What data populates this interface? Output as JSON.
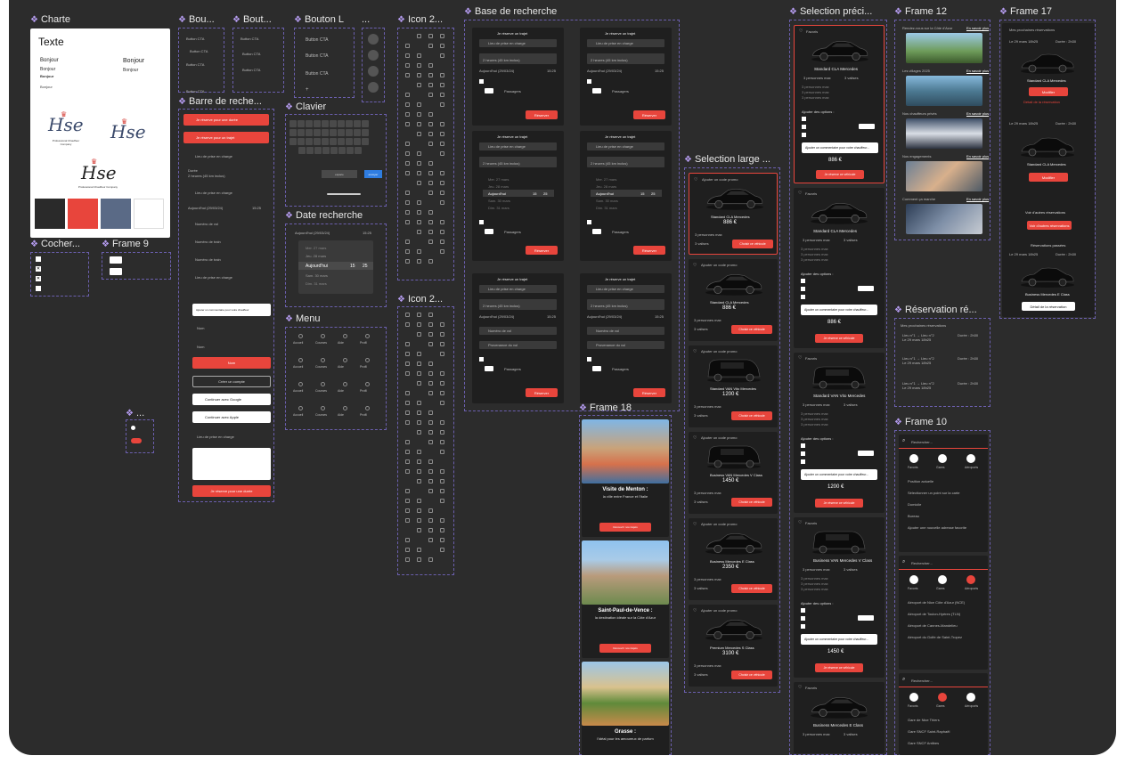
{
  "canvas": {
    "background": "#2c2c2c",
    "accent": "#e8453c",
    "panel": "#1f1f1f"
  },
  "frames": {
    "charte": "Charte",
    "bouton1": "Bou...",
    "bouton2": "Bout...",
    "boutonL": "Bouton L",
    "dots": "...",
    "icon1": "Icon 2...",
    "icon2": "Icon 2...",
    "base": "Base de recherche",
    "selPrec": "Selection préci...",
    "frame12": "Frame 12",
    "frame17": "Frame 17",
    "selLarge": "Selection large ...",
    "cocher": "Cocher...",
    "frame9": "Frame 9",
    "barre": "Barre de reche...",
    "clavier": "Clavier",
    "dateRech": "Date recherche",
    "menu": "Menu",
    "frame18": "Frame 18",
    "resa": "Réservation ré...",
    "frame10": "Frame 10",
    "dots2": "..."
  },
  "charte": {
    "title": "Texte",
    "bonjour": [
      "Bonjour",
      "Bonjour",
      "Bonjour",
      "Bonjour",
      "Bonjour",
      "Bonjour"
    ],
    "logo_text": "Hse",
    "logo_sub": "Professional Chauffeur Company",
    "swatches": [
      "#2a2a2a",
      "#e8453c",
      "#5a6a86",
      "#ffffff"
    ]
  },
  "buttons": {
    "cta": "Button CTA",
    "ctaL": "Button CTA"
  },
  "barre": {
    "r1": "Je réserve pour une durée",
    "r2": "Je réserve pour un trajet",
    "lieu": "Lieu de prise en charge",
    "duree": "Durée",
    "duree_val": "2 heures (45 km inclus)",
    "date": "Aujourd'hui (29/03/24)",
    "heure": "15:25",
    "vol": "Numéro de vol",
    "train": "Numéro de train",
    "nom": "Nom",
    "note": "Ajouter un commentaire pour votre chauffeur",
    "create": "Créer un compte",
    "google": "Continuer avec Google",
    "apple": "Continuer avec Apple"
  },
  "clavier": {
    "space": "espace",
    "send": "envoyer"
  },
  "date": {
    "header": "Aujourd'hui (29/03/24)",
    "time": "15:25",
    "rows": [
      "Mer. 27 mars",
      "Jeu. 28 mars",
      "Aujourd'hui",
      "Sam. 30 mars",
      "Dim. 31 mars"
    ],
    "hours": [
      "13",
      "14",
      "15",
      "16",
      "17"
    ],
    "mins": [
      "23",
      "24",
      "25",
      "26",
      "27"
    ]
  },
  "menu": {
    "items": [
      "Accueil",
      "Courses",
      "Aide",
      "Profil"
    ]
  },
  "base": {
    "title": "Je réserve un trajet",
    "lieu": "Lieu de prise en charge",
    "duree": "2 heures (45 km inclus)",
    "date": "Aujourd'hui (29/03/24)",
    "heure": "15:25",
    "passagers": "Passagers",
    "reserve": "Réserver",
    "vol": "Numéro de vol",
    "train": "Provenance du vol"
  },
  "cars": [
    {
      "name": "Standard CLA Mercedes",
      "price": "886 €"
    },
    {
      "name": "Standard CLA Mercedes",
      "price": "886 €"
    },
    {
      "name": "Standard VAN Vito Mercedes",
      "price": "1200 €"
    },
    {
      "name": "Business VAN Mercedes V Class",
      "price": "1450 €"
    },
    {
      "name": "Business Mercedes E Class",
      "price": "2350 €"
    },
    {
      "name": "Premium Mercedes S Class",
      "price": "3100 €"
    }
  ],
  "selPrec": {
    "favori": "Favoris",
    "car": "Standard CLA Mercedes",
    "p1": "3 personnes max",
    "p2": "3 valises",
    "options": "Ajouter des options :",
    "comment": "Ajouter un commentaire pour votre chauffeur...",
    "prices": [
      "886 €",
      "886 €",
      "1200 €",
      "1450 €"
    ],
    "cta": "Je réserve ce véhicule",
    "cars": [
      "Standard CLA Mercedes",
      "Standard CLA Mercedes",
      "Standard VAN Vito Mercedes",
      "Business VAN Mercedes V Class",
      "Business Mercedes E Class"
    ]
  },
  "selLarge": {
    "cta": "Choisir ce véhicule",
    "add": "Ajouter un code promo"
  },
  "frame12": {
    "rows": [
      "Rendez-vous sur la Côte d'Azur",
      "Les villages 2025",
      "Nos chauffeurs privés",
      "Nos engagements",
      "Comment ça marche"
    ],
    "link": "En savoir plus"
  },
  "frame17": {
    "title": "Mes prochaines réservations",
    "dep": "Lieu de prise en charge",
    "date": "Le 29 mars 18h25",
    "dur": "Durée : 2h30",
    "car": "Standard CLA Mercedes",
    "cta": "Modifier",
    "cta2": "Détail de la réservation",
    "past": "Réservations passées",
    "carS": "Standard CLA Mercedes",
    "carE": "Business Mercedes E Class",
    "autre": "Voir d'autres réservations"
  },
  "frame18": {
    "cards": [
      {
        "title": "Visite de Menton :",
        "sub": "la ville entre France et l'Italie",
        "cta": "Découvrir nos trajets"
      },
      {
        "title": "Saint-Paul-de-Vence :",
        "sub": "la destination idéale sur la Côte d'Azur",
        "cta": "Découvrir nos trajets"
      },
      {
        "title": "Grasse :",
        "sub": "l'idéal pour les amoureux de parfum",
        "cta": ""
      }
    ]
  },
  "resa": {
    "title": "Mes prochaines réservations",
    "row": "Lieu n°1 → Lieu n°2",
    "date": "Le 29 mars 18h25",
    "dur": "Durée : 2h30"
  },
  "frame10": {
    "search": "Rechercher...",
    "tabs": [
      "Favoris",
      "Gares",
      "Aéroports"
    ],
    "items1": [
      "Position actuelle",
      "Sélectionner un point sur la carte",
      "Domicile",
      "Bureau",
      "Ajouter une nouvelle adresse favorite"
    ],
    "items2": [
      "Aéroport de Nice Côte d'Azur (NCE)",
      "Aéroport de Toulon-Hyères (TLN)",
      "Aéroport de Cannes-Mandelieu",
      "Aéroport du Golfe de Saint-Tropez"
    ],
    "items3": [
      "Gare de Nice Thiers",
      "Gare SNCF Saint-Raphaël",
      "Gare SNCF Antibes"
    ]
  }
}
